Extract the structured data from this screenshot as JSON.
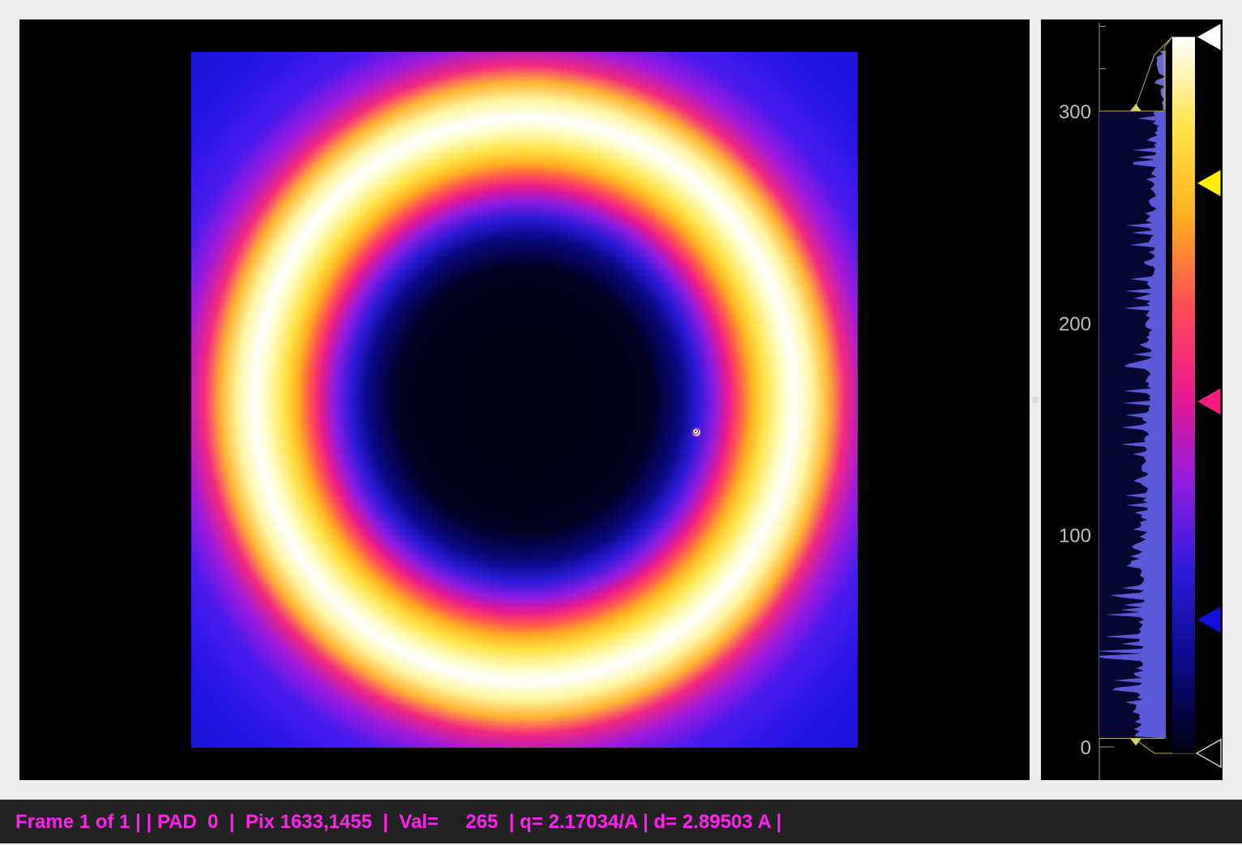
{
  "colors": {
    "status_text": "#ff22ee",
    "status_background": "#222222",
    "panel_background": "#000000",
    "window_background": "#ececec",
    "colormap": [
      "#000010",
      "#0a0a85",
      "#2a1ad8",
      "#8d1ce0",
      "#e8198f",
      "#ff4d55",
      "#ffb020",
      "#ffe44a",
      "#ffffff"
    ]
  },
  "colorbar": {
    "axis_min": -5,
    "axis_max": 340,
    "tick_labels": [
      "0",
      "100",
      "200",
      "300"
    ],
    "tick_values": [
      0,
      100,
      200,
      300
    ],
    "range_low": 4,
    "range_high": 300,
    "display_max": 330,
    "color_stops": [
      {
        "value": 60,
        "color": "#1010d8"
      },
      {
        "value": 163,
        "color": "#ff1a80"
      },
      {
        "value": 266,
        "color": "#ffee00"
      },
      {
        "value": 335,
        "color": "#ffffff"
      },
      {
        "value": -3,
        "color": "#000000"
      }
    ]
  },
  "status": {
    "text": "Frame 1 of 1 | | PAD  0  |  Pix 1633,1455  |  Val=     265  | q= 2.17034/A | d= 2.89503 A |"
  }
}
